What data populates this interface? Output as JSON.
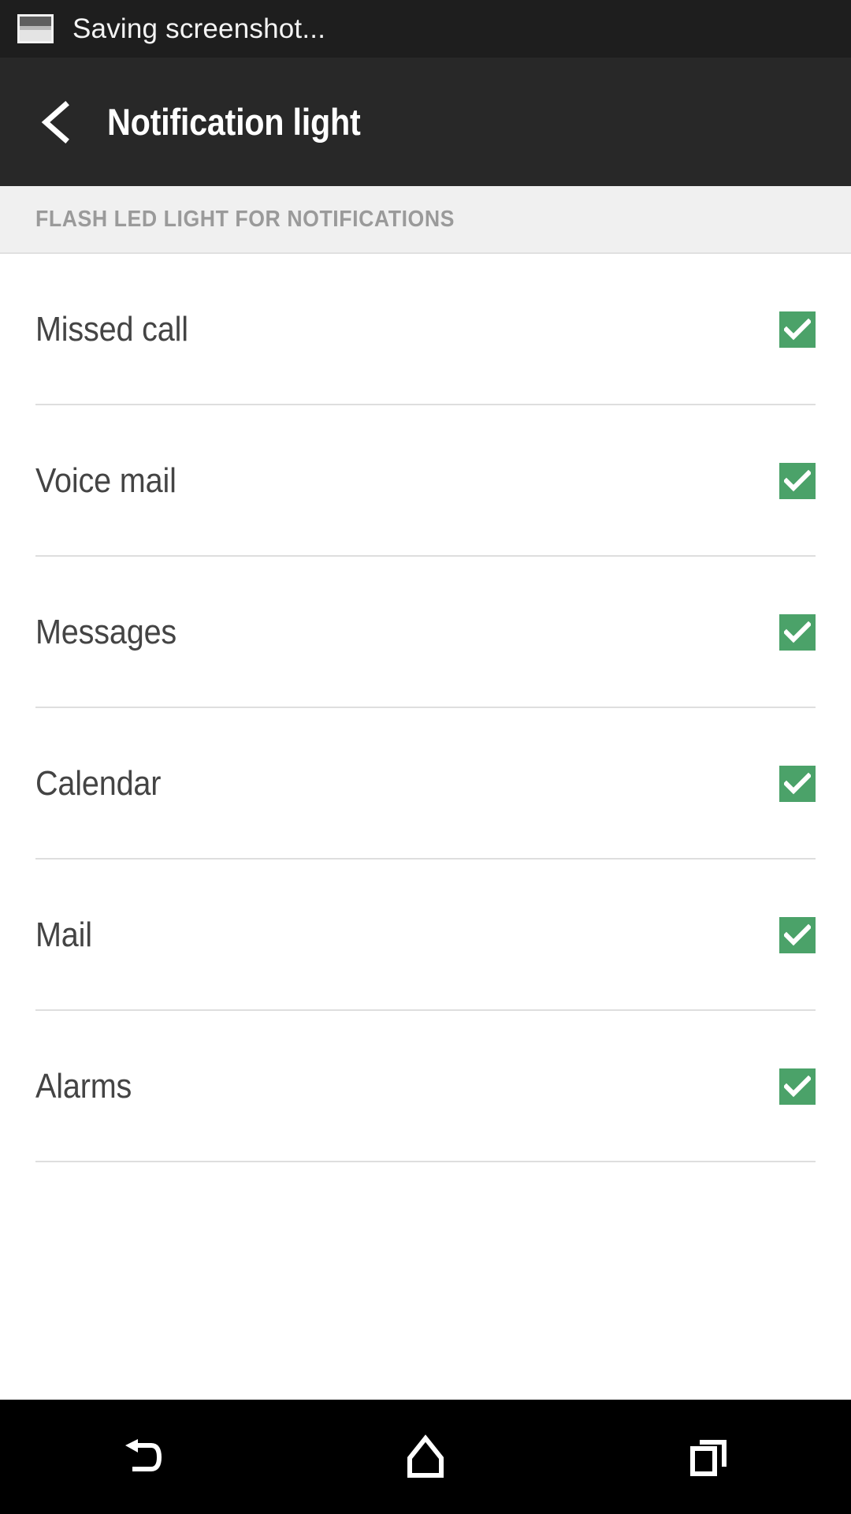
{
  "status_bar": {
    "icon": "screenshot-image-icon",
    "text": "Saving screenshot...",
    "background": "#1e1e1e"
  },
  "toolbar": {
    "back_icon": "back-chevron-icon",
    "title": "Notification light",
    "background": "#282828"
  },
  "section": {
    "header": "FLASH LED LIGHT FOR NOTIFICATIONS",
    "header_color": "#9a9a9a",
    "background": "#f0f0f0"
  },
  "theme": {
    "checkbox_green": "#4ba269",
    "row_text": "#444444",
    "divider": "#dedede"
  },
  "list": {
    "items": [
      {
        "label": "Missed call",
        "checked": true,
        "checkmark": "check-icon"
      },
      {
        "label": "Voice mail",
        "checked": true,
        "checkmark": "check-icon"
      },
      {
        "label": "Messages",
        "checked": true,
        "checkmark": "check-icon"
      },
      {
        "label": "Calendar",
        "checked": true,
        "checkmark": "check-icon"
      },
      {
        "label": "Mail",
        "checked": true,
        "checkmark": "check-icon"
      },
      {
        "label": "Alarms",
        "checked": true,
        "checkmark": "check-icon"
      }
    ]
  },
  "nav_bar": {
    "background": "#000000",
    "buttons": [
      {
        "name": "back",
        "icon": "nav-back-icon"
      },
      {
        "name": "home",
        "icon": "nav-home-icon"
      },
      {
        "name": "recents",
        "icon": "nav-recents-icon"
      }
    ]
  }
}
